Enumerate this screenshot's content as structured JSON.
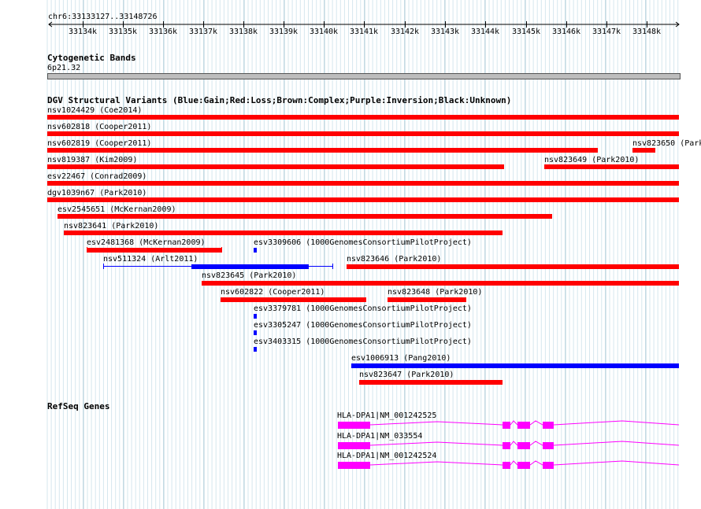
{
  "ruler": {
    "region_label": "chr6:33133127..33148726",
    "ticks": [
      {
        "label": "33134k"
      },
      {
        "label": "33135k"
      },
      {
        "label": "33136k"
      },
      {
        "label": "33137k"
      },
      {
        "label": "33138k"
      },
      {
        "label": "33139k"
      },
      {
        "label": "33140k"
      },
      {
        "label": "33141k"
      },
      {
        "label": "33142k"
      },
      {
        "label": "33143k"
      },
      {
        "label": "33144k"
      },
      {
        "label": "33145k"
      },
      {
        "label": "33146k"
      },
      {
        "label": "33147k"
      },
      {
        "label": "33148k"
      }
    ]
  },
  "cytoband": {
    "title": "Cytogenetic Bands",
    "band_label": "6p21.32"
  },
  "dgv": {
    "title": "DGV Structural Variants (Blue:Gain;Red:Loss;Brown:Complex;Purple:Inversion;Black:Unknown)",
    "colors": {
      "loss": "#ff0000",
      "gain": "#0000ff"
    },
    "variants": [
      {
        "label": "nsv1024429 (Coe2014)"
      },
      {
        "label": "nsv602818 (Cooper2011)"
      },
      {
        "label": "nsv602819 (Cooper2011)"
      },
      {
        "label": "nsv823650 (Park"
      },
      {
        "label": "nsv819387 (Kim2009)"
      },
      {
        "label": "nsv823649 (Park2010)"
      },
      {
        "label": "esv22467 (Conrad2009)"
      },
      {
        "label": "dgv1039n67 (Park2010)"
      },
      {
        "label": "esv2545651 (McKernan2009)"
      },
      {
        "label": "nsv823641 (Park2010)"
      },
      {
        "label": "esv2481368 (McKernan2009)"
      },
      {
        "label": "esv3309606 (1000GenomesConsortiumPilotProject)"
      },
      {
        "label": "nsv511324 (Arlt2011)"
      },
      {
        "label": "nsv823646 (Park2010)"
      },
      {
        "label": "nsv823645 (Park2010)"
      },
      {
        "label": "nsv602822 (Cooper2011)"
      },
      {
        "label": "nsv823648 (Park2010)"
      },
      {
        "label": "esv3379781 (1000GenomesConsortiumPilotProject)"
      },
      {
        "label": "esv3305247 (1000GenomesConsortiumPilotProject)"
      },
      {
        "label": "esv3403315 (1000GenomesConsortiumPilotProject)"
      },
      {
        "label": "esv1006913 (Pang2010)"
      },
      {
        "label": "nsv823647 (Park2010)"
      }
    ]
  },
  "refseq": {
    "title": "RefSeq Genes",
    "color": "#ff00ff",
    "genes": [
      {
        "label": "HLA-DPA1|NM_001242525"
      },
      {
        "label": "HLA-DPA1|NM_033554"
      },
      {
        "label": "HLA-DPA1|NM_001242524"
      }
    ]
  }
}
